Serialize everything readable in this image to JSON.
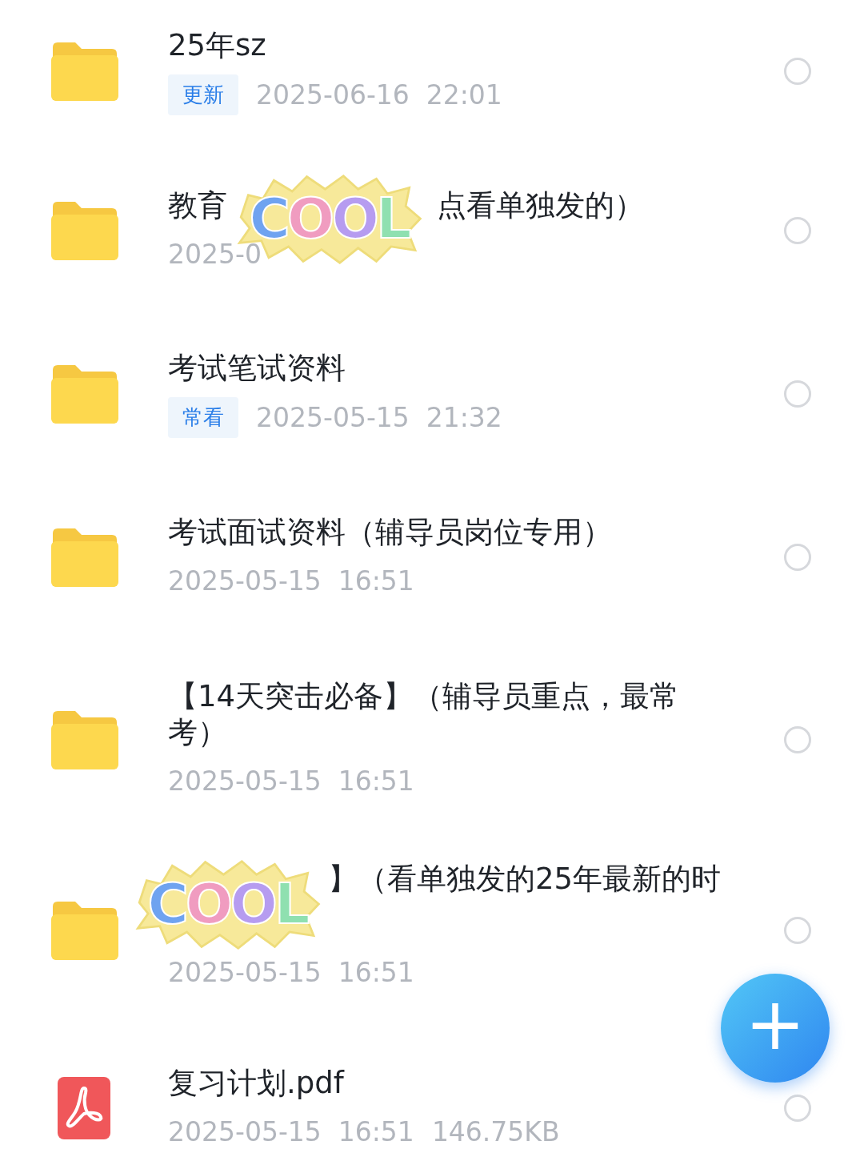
{
  "files": [
    {
      "kind": "folder",
      "title": "25年sz",
      "tag": "更新",
      "date": "2025-06-16  22:01",
      "selected": false
    },
    {
      "kind": "folder",
      "title": "教育",
      "title_after": "点看单独发的）",
      "date": "2025-0",
      "sticker": "COOL",
      "selected": false
    },
    {
      "kind": "folder",
      "title": "考试笔试资料",
      "tag": "常看",
      "date": "2025-05-15  21:32",
      "selected": false
    },
    {
      "kind": "folder",
      "title": "考试面试资料（辅导员岗位专用）",
      "date": "2025-05-15  16:51",
      "selected": false
    },
    {
      "kind": "folder",
      "title": "【14天突击必备】（辅导员重点，最常考）",
      "date": "2025-05-15  16:51",
      "selected": false
    },
    {
      "kind": "folder",
      "title_after": "】（看单独发的25年最新的时",
      "date": "2025-05-15  16:51",
      "sticker": "COOL",
      "selected": false
    },
    {
      "kind": "pdf",
      "title": "复习计划.pdf",
      "date": "2025-05-15  16:51",
      "size": "146.75KB",
      "selected": false
    }
  ],
  "fab": {
    "label": "+"
  }
}
